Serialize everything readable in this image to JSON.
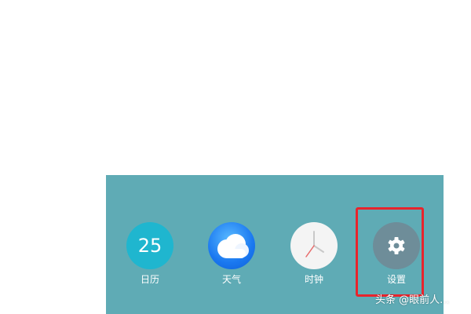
{
  "dock": {
    "background": "#5fabb5",
    "apps": [
      {
        "label": "日历",
        "icon": "calendar-icon",
        "day": "25",
        "color": "#1fb6cf"
      },
      {
        "label": "天气",
        "icon": "weather-cloud-icon",
        "color": "#1a78f0"
      },
      {
        "label": "时钟",
        "icon": "clock-icon",
        "color": "#f4f4f4"
      },
      {
        "label": "设置",
        "icon": "gear-icon",
        "color": "#6e8d99"
      }
    ]
  },
  "highlight": {
    "color": "#e8242c"
  },
  "watermark": {
    "text": "头条 @眼前人..."
  }
}
